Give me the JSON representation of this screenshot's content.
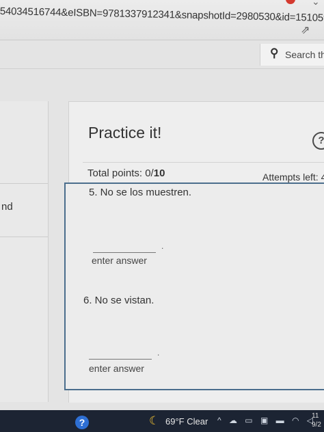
{
  "browser": {
    "url": "54034516744&eISBN=9781337912341&snapshotId=2980530&id=151059...",
    "share_icon": "share-icon"
  },
  "search": {
    "icon": "search-icon",
    "label": "Search thi"
  },
  "sidebar": {
    "partial_text": "nd"
  },
  "practice": {
    "title": "Practice it!",
    "help_icon": "?",
    "total_points_label": "Total points: 0/",
    "total_points_max": "10",
    "attempts_label": "Attempts left: 4"
  },
  "questions": [
    {
      "prompt": "5. No se los muestren.",
      "placeholder": "enter answer"
    },
    {
      "prompt": "6. No se vistan.",
      "placeholder": "enter answer"
    }
  ],
  "taskbar": {
    "app_icon": "?",
    "weather_icon": "moon-icon",
    "weather": "69°F  Clear",
    "tray": "^ ☁ ▭ ▣ ▬ ◠ ◁",
    "clock_time": "11",
    "clock_date": "9/2"
  }
}
